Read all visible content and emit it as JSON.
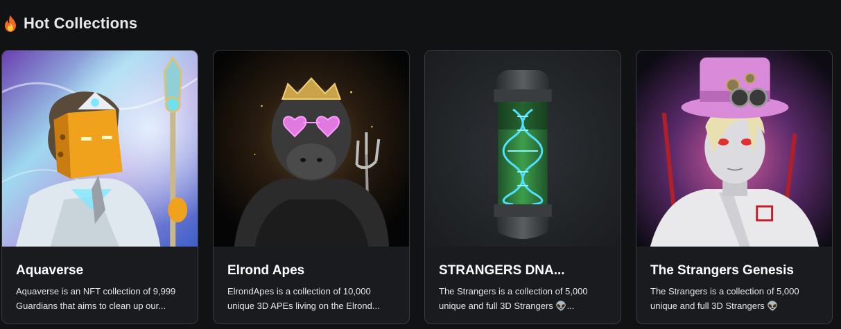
{
  "header": {
    "icon": "fire-icon",
    "title": "Hot Collections"
  },
  "collections": [
    {
      "name": "Aquaverse",
      "description": "Aquaverse is an NFT collection of 9,999 Guardians that aims to clean up our...",
      "image_icon": "cube-head-guardian-icon"
    },
    {
      "name": "Elrond Apes",
      "description": "ElrondApes is a collection of 10,000 unique 3D APEs living on the Elrond...",
      "image_icon": "crowned-ape-icon"
    },
    {
      "name": "STRANGERS DNA...",
      "description": "The Strangers is a collection of 5,000 unique and full 3D Strangers 👽...",
      "image_icon": "dna-capsule-icon"
    },
    {
      "name": "The Strangers Genesis",
      "description": "The Strangers is a collection of 5,000 unique and full 3D Strangers 👽",
      "image_icon": "top-hat-stranger-icon"
    }
  ],
  "colors": {
    "background": "#111214",
    "card_background": "#1a1b1e",
    "card_border": "#3a3b3f"
  }
}
